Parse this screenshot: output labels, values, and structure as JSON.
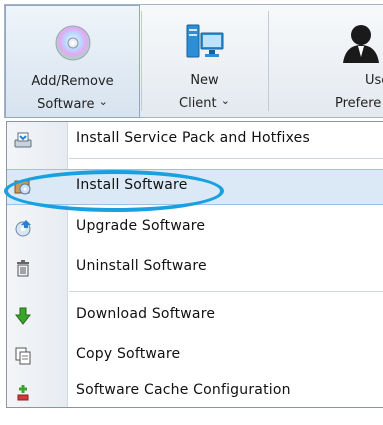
{
  "ribbon": {
    "buttons": [
      {
        "line1": "Add/Remove",
        "line2": "Software",
        "dropdown": "⌄"
      },
      {
        "line1": "New",
        "line2": "Client",
        "dropdown": "⌄"
      },
      {
        "line1": "Use",
        "line2": "Prefere"
      }
    ]
  },
  "menu": {
    "items": [
      {
        "label": "Install Service Pack and Hotfixes",
        "icon": "install-service-pack-icon"
      },
      {
        "label": "Install Software",
        "icon": "install-software-icon",
        "highlighted": true
      },
      {
        "label": "Upgrade Software",
        "icon": "upgrade-software-icon"
      },
      {
        "label": "Uninstall Software",
        "icon": "trash-icon"
      },
      {
        "label": "Download Software",
        "icon": "download-arrow-icon"
      },
      {
        "label": "Copy Software",
        "icon": "copy-icon"
      },
      {
        "label": "Software Cache Configuration",
        "icon": "cache-config-icon"
      }
    ]
  },
  "colors": {
    "highlight_ring": "#1aa0e0",
    "selected_row": "#dbe9f6",
    "download_arrow": "#3aa52a"
  }
}
